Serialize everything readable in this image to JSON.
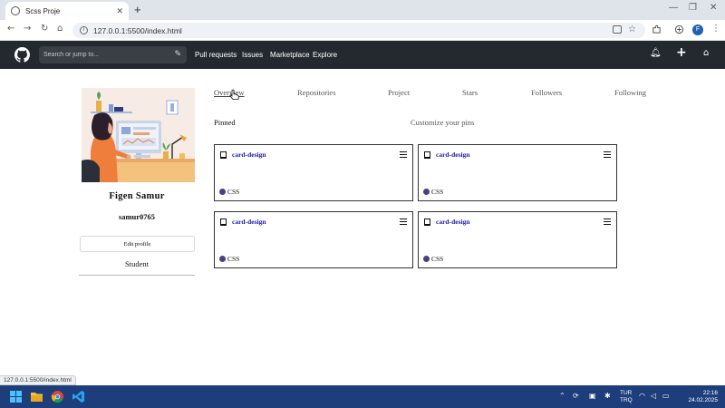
{
  "browser": {
    "tab_title": "Scss Proje",
    "url": "127.0.0.1:5500/index.html",
    "profile_initial": "F"
  },
  "github": {
    "search_placeholder": "Search or jump to...",
    "nav": [
      "Pull requests",
      "Issues",
      "Marketplace",
      "Explore"
    ]
  },
  "profile": {
    "name": "Figen Samur",
    "username": "samur0765",
    "edit_label": "Edit profile",
    "bio": "Student"
  },
  "tabs": [
    "Overview",
    "Repositories",
    "Project",
    "Stars",
    "Followers",
    "Following"
  ],
  "active_tab": "Overview",
  "pinned": {
    "label": "Pinned",
    "customize_label": "Customize your pins",
    "cards": [
      {
        "name": "card-design",
        "language": "CSS"
      },
      {
        "name": "card-design",
        "language": "CSS"
      },
      {
        "name": "card-design",
        "language": "CSS"
      },
      {
        "name": "card-design",
        "language": "CSS"
      }
    ]
  },
  "status_url": "127.0.0.1:5500/index.html",
  "taskbar": {
    "lang_line1": "TUR",
    "lang_line2": "TRQ",
    "time": "22:16",
    "date": "24.02.2025"
  },
  "colors": {
    "github_header": "#24292f",
    "repo_link": "#1a1aa8",
    "css_dot": "#4a3f85",
    "taskbar": "#1d3e7a"
  }
}
